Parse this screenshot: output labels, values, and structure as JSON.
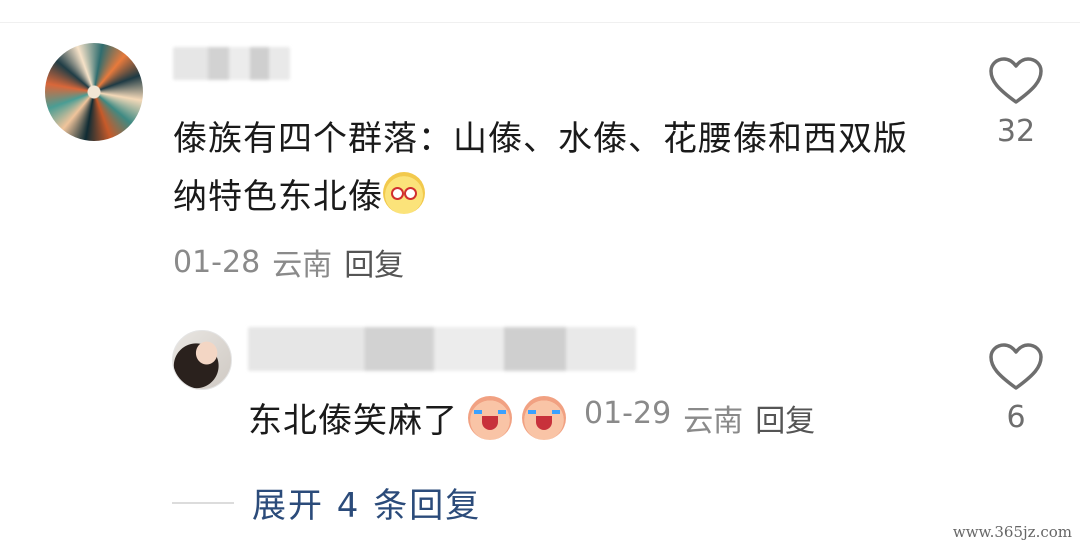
{
  "main_comment": {
    "text": "傣族有四个群落：山傣、水傣、花腰傣和西双版纳特色东北傣",
    "emoji": "pear-face-emoji",
    "date": "01-28",
    "location": "云南",
    "reply_label": "回复",
    "like_count": "32"
  },
  "reply_comment": {
    "text": "东北傣笑麻了",
    "emojis": [
      "crying-face-emoji",
      "crying-face-emoji"
    ],
    "date": "01-29",
    "location": "云南",
    "reply_label": "回复",
    "like_count": "6"
  },
  "expand": {
    "label": "展开 4 条回复"
  },
  "watermark": "www.365jz.com",
  "colors": {
    "link": "#2b4b7a",
    "meta": "#8a8a8a",
    "text": "#1a1a1a"
  }
}
